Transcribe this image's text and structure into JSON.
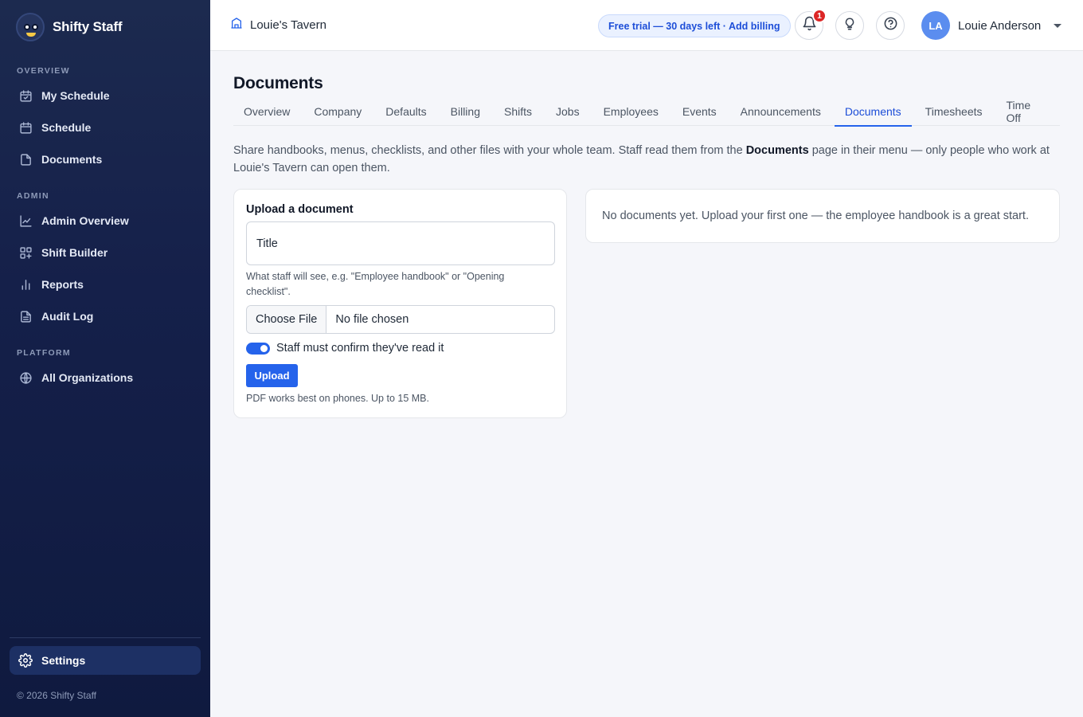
{
  "app": {
    "name": "Shifty Staff",
    "copyright": "© 2026 Shifty Staff"
  },
  "sidebar": {
    "sections": [
      {
        "title": "OVERVIEW",
        "items": [
          {
            "label": "My Schedule",
            "icon": "calendar-check-icon"
          },
          {
            "label": "Schedule",
            "icon": "calendar-icon"
          },
          {
            "label": "Documents",
            "icon": "file-icon"
          }
        ]
      },
      {
        "title": "ADMIN",
        "items": [
          {
            "label": "Admin Overview",
            "icon": "line-chart-icon"
          },
          {
            "label": "Shift Builder",
            "icon": "grid-plus-icon"
          },
          {
            "label": "Reports",
            "icon": "bar-chart-icon"
          },
          {
            "label": "Audit Log",
            "icon": "file-text-icon"
          }
        ]
      },
      {
        "title": "PLATFORM",
        "items": [
          {
            "label": "All Organizations",
            "icon": "globe-icon"
          }
        ]
      }
    ],
    "settings": {
      "label": "Settings",
      "icon": "gear-icon"
    }
  },
  "topbar": {
    "org_name": "Louie's Tavern",
    "trial_text": "Free trial — 30 days left · Add billing",
    "notification_count": "1",
    "user": {
      "initials": "LA",
      "name": "Louie Anderson"
    }
  },
  "page": {
    "title": "Documents",
    "tabs": [
      "Overview",
      "Company",
      "Defaults",
      "Billing",
      "Shifts",
      "Jobs",
      "Employees",
      "Events",
      "Announcements",
      "Documents",
      "Timesheets",
      "Time Off"
    ],
    "active_tab": "Documents",
    "intro_before": "Share handbooks, menus, checklists, and other files with your whole team. Staff read them from the ",
    "intro_bold": "Documents",
    "intro_after": " page in their menu — only people who work at Louie's Tavern can open them."
  },
  "upload": {
    "title": "Upload a document",
    "title_placeholder": "Title",
    "hint": "What staff will see, e.g. \"Employee handbook\" or \"Opening checklist\".",
    "choose_file_label": "Choose File",
    "file_status": "No file chosen",
    "confirm_toggle_label": "Staff must confirm they've read it",
    "confirm_toggle_on": true,
    "upload_button": "Upload",
    "note": "PDF works best on phones. Up to 15 MB."
  },
  "documents": {
    "empty_text": "No documents yet. Upload your first one — the employee handbook is a great start."
  },
  "colors": {
    "accent": "#2563eb",
    "sidebar": "#15204a",
    "badge": "#dc2626"
  }
}
